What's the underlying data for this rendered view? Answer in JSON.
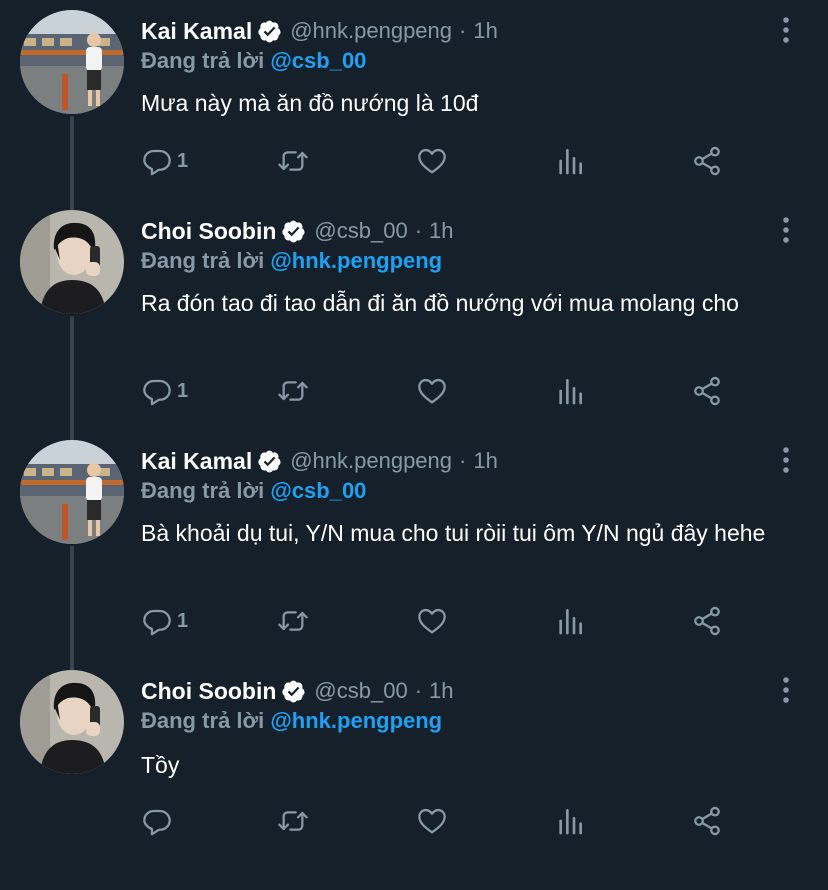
{
  "colors": {
    "background": "#15202b",
    "secondary_text": "#8899a6",
    "accent": "#1da1f2",
    "thread_line": "#38444d"
  },
  "tweets": [
    {
      "name": "Kai Kamal",
      "handle": "@hnk.pengpeng",
      "dot": "·",
      "time": "1h",
      "reply_prefix": "Đang trả lời",
      "reply_to": "@csb_00",
      "text": "Mưa này mà ăn đồ nướng là 10đ",
      "reply_count": "1",
      "avatar_icon": "avatar-kai"
    },
    {
      "name": "Choi Soobin",
      "handle": "@csb_00",
      "dot": "·",
      "time": "1h",
      "reply_prefix": "Đang trả lời",
      "reply_to": "@hnk.pengpeng",
      "text": "Ra đón tao đi tao dẫn đi ăn đồ nướng với mua molang cho",
      "reply_count": "1",
      "avatar_icon": "avatar-soobin"
    },
    {
      "name": "Kai Kamal",
      "handle": "@hnk.pengpeng",
      "dot": "·",
      "time": "1h",
      "reply_prefix": "Đang trả lời",
      "reply_to": "@csb_00",
      "text": "Bà khoải dụ tui, Y/N mua cho tui ròii tui ôm Y/N ngủ đây hehe",
      "reply_count": "1",
      "avatar_icon": "avatar-kai"
    },
    {
      "name": "Choi Soobin",
      "handle": "@csb_00",
      "dot": "·",
      "time": "1h",
      "reply_prefix": "Đang trả lời",
      "reply_to": "@hnk.pengpeng",
      "text": "Tồy",
      "reply_count": "",
      "avatar_icon": "avatar-soobin"
    }
  ]
}
